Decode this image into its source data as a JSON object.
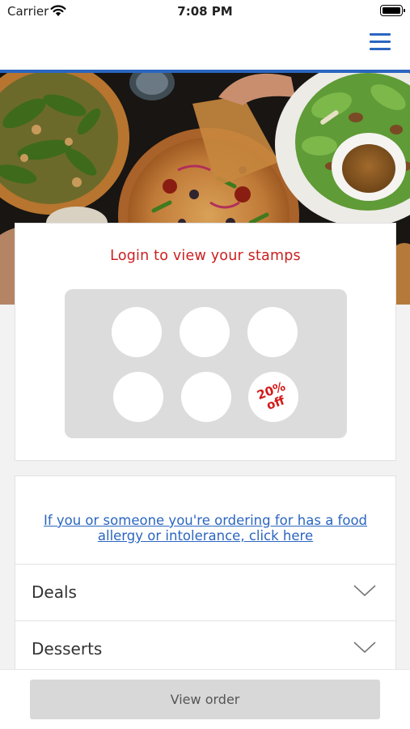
{
  "status_bar": {
    "carrier": "Carrier",
    "time": "7:08 PM"
  },
  "nav": {
    "menu_icon": "hamburger-menu-icon",
    "accent_color": "#2b66c0"
  },
  "hero": {
    "image": "food-photo-pizzas-and-salad"
  },
  "stamps": {
    "title": "Login to view your stamps",
    "title_color": "#cc2020",
    "total_stamps": 6,
    "reward_line_1": "20%",
    "reward_line_2": "off",
    "reward_color": "#d41a1a"
  },
  "menu": {
    "allergy_link": "If you or someone you're ordering for has a food allergy or intolerance, click here",
    "categories": [
      {
        "label": "Deals",
        "icon": "chevron-down-icon"
      },
      {
        "label": "Desserts",
        "icon": "chevron-down-icon"
      }
    ]
  },
  "footer": {
    "view_order_label": "View order"
  }
}
